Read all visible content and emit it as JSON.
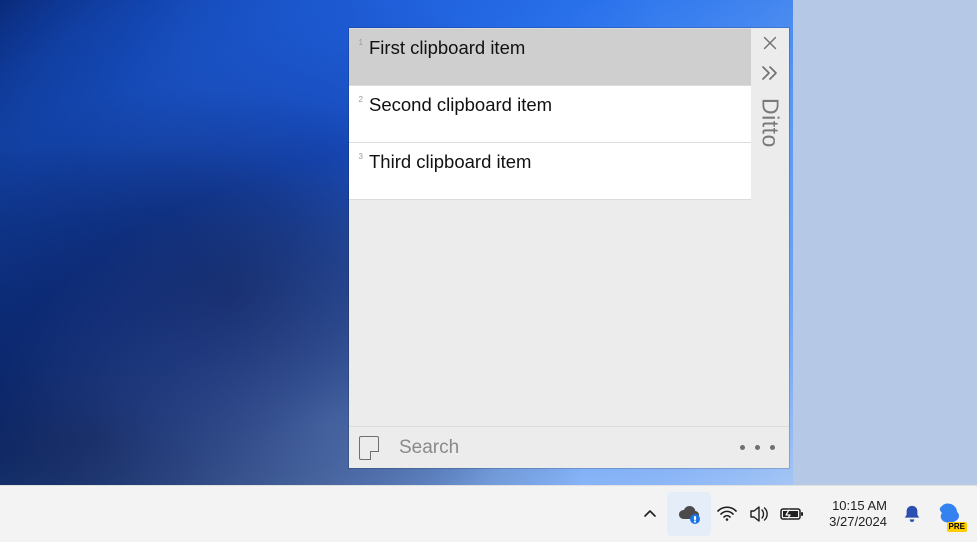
{
  "app": {
    "name": "Ditto"
  },
  "clips": [
    {
      "index": "1",
      "text": "First clipboard item",
      "selected": true
    },
    {
      "index": "2",
      "text": "Second clipboard item",
      "selected": false
    },
    {
      "index": "3",
      "text": "Third clipboard item",
      "selected": false
    }
  ],
  "search": {
    "placeholder": "Search",
    "value": ""
  },
  "taskbar": {
    "time": "10:15 AM",
    "date": "3/27/2024",
    "copilot_badge": "PRE"
  },
  "icons": {
    "close": "✕",
    "chevron_double_right": "❯❯",
    "chevron_up": "˄"
  }
}
